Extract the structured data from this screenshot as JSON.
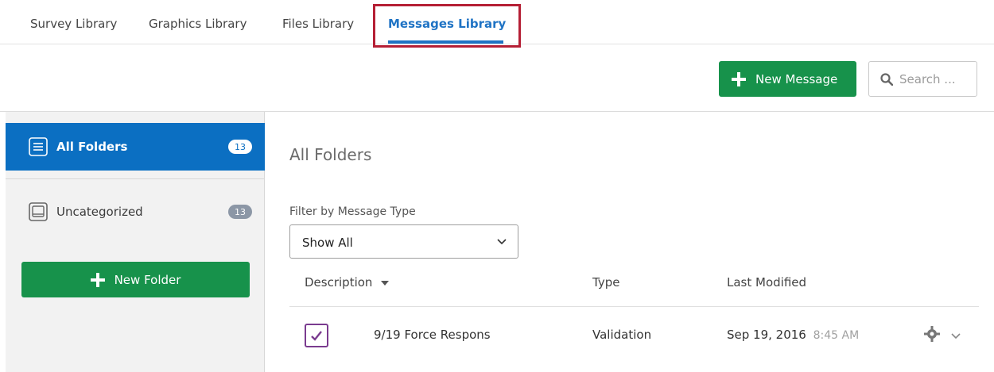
{
  "tabs": [
    {
      "label": "Survey Library"
    },
    {
      "label": "Graphics Library"
    },
    {
      "label": "Files Library"
    },
    {
      "label": "Messages Library"
    }
  ],
  "toolbar": {
    "new_message_label": "New Message",
    "search_placeholder": "Search ..."
  },
  "sidebar": {
    "folders": [
      {
        "label": "All Folders",
        "count": "13"
      },
      {
        "label": "Uncategorized",
        "count": "13"
      }
    ],
    "new_folder_label": "New Folder"
  },
  "main": {
    "title": "All Folders",
    "filter_label": "Filter by Message Type",
    "filter_value": "Show All",
    "columns": {
      "description": "Description",
      "type": "Type",
      "last_modified": "Last Modified"
    },
    "rows": [
      {
        "description": "9/19 Force Respons",
        "type": "Validation",
        "date": "Sep 19, 2016",
        "time": "8:45 AM"
      }
    ]
  },
  "colors": {
    "accent_blue": "#0b6fc2",
    "button_green": "#17924b",
    "highlight_red": "#b51f35"
  }
}
